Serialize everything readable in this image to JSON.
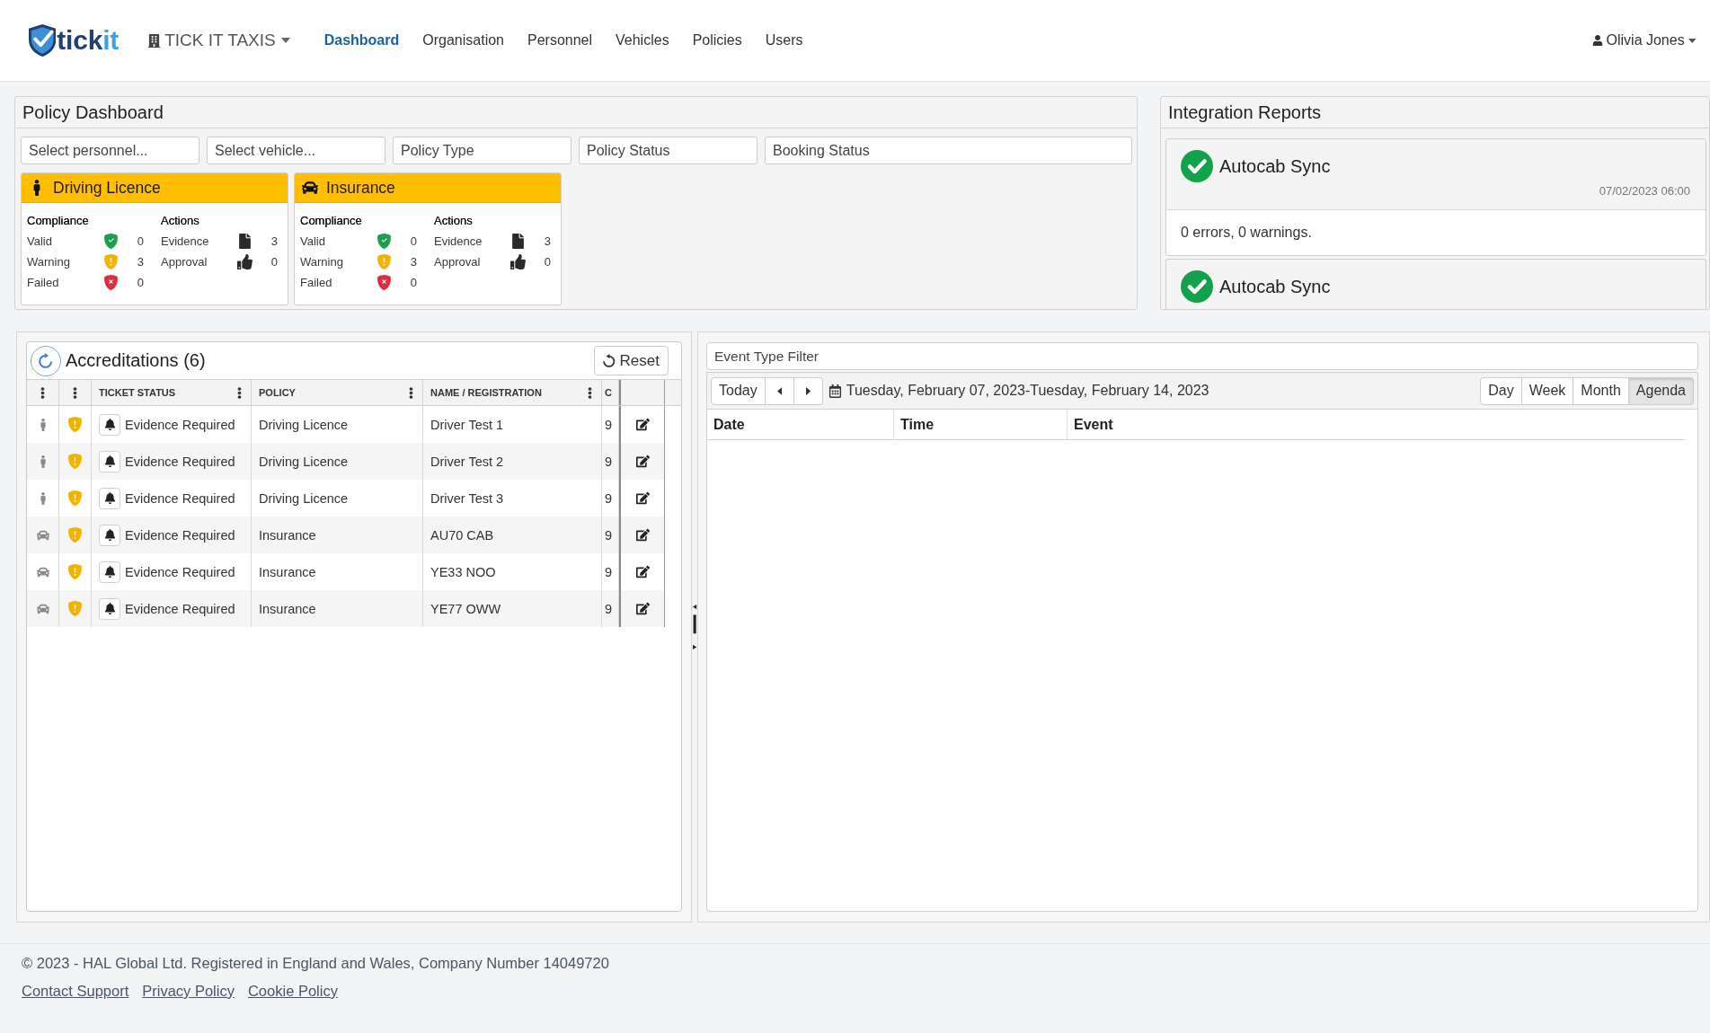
{
  "header": {
    "logo": [
      {
        "text": "tick",
        "color": "#22406e"
      },
      {
        "text": "it",
        "color": "#3f9fe0"
      }
    ],
    "organisation": "TICK IT TAXIS",
    "nav": [
      {
        "label": "Dashboard",
        "selected": true
      },
      {
        "label": "Organisation",
        "selected": false
      },
      {
        "label": "Personnel",
        "selected": false
      },
      {
        "label": "Vehicles",
        "selected": false
      },
      {
        "label": "Policies",
        "selected": false
      },
      {
        "label": "Users",
        "selected": false
      }
    ],
    "user": "Olivia Jones"
  },
  "policy_dashboard": {
    "title": "Policy Dashboard",
    "filters": [
      {
        "placeholder": "Select personnel..."
      },
      {
        "placeholder": "Select vehicle..."
      },
      {
        "placeholder": "Policy Type"
      },
      {
        "placeholder": "Policy Status"
      },
      {
        "placeholder": "Booking Status"
      }
    ],
    "cards": [
      {
        "kind": "person",
        "title": "Driving Licence",
        "compliance_heading": "Compliance",
        "actions_heading": "Actions",
        "compliance": [
          {
            "kind": "valid",
            "label": "Valid",
            "count": "0"
          },
          {
            "kind": "warning",
            "label": "Warning",
            "count": "3"
          },
          {
            "kind": "failed",
            "label": "Failed",
            "count": "0"
          }
        ],
        "actions": [
          {
            "kind": "evidence",
            "label": "Evidence",
            "count": "3"
          },
          {
            "kind": "approval",
            "label": "Approval",
            "count": "0"
          }
        ]
      },
      {
        "kind": "car",
        "title": "Insurance",
        "compliance_heading": "Compliance",
        "actions_heading": "Actions",
        "compliance": [
          {
            "kind": "valid",
            "label": "Valid",
            "count": "0"
          },
          {
            "kind": "warning",
            "label": "Warning",
            "count": "3"
          },
          {
            "kind": "failed",
            "label": "Failed",
            "count": "0"
          }
        ],
        "actions": [
          {
            "kind": "evidence",
            "label": "Evidence",
            "count": "3"
          },
          {
            "kind": "approval",
            "label": "Approval",
            "count": "0"
          }
        ]
      }
    ]
  },
  "integration_reports": {
    "title": "Integration Reports",
    "reports": [
      {
        "kind": "success",
        "name": "Autocab Sync",
        "time": "07/02/2023 06:00",
        "summary": "0 errors, 0 warnings."
      },
      {
        "kind": "success",
        "name": "Autocab Sync"
      }
    ]
  },
  "accreditations": {
    "title": "Accreditations (6)",
    "reset_label": "Reset",
    "columns": [
      {
        "label": "TICKET STATUS",
        "menu": true
      },
      {
        "label": "POLICY",
        "menu": true
      },
      {
        "label": "NAME / REGISTRATION",
        "menu": true
      },
      {
        "label": "C",
        "menu": false
      }
    ],
    "rows": [
      {
        "kind": "person",
        "compliance": {
          "kind": "warning"
        },
        "ticket_status": "Evidence Required",
        "policy": "Driving Licence",
        "name": "Driver Test 1",
        "column_6": "9"
      },
      {
        "kind": "person",
        "compliance": {
          "kind": "warning"
        },
        "ticket_status": "Evidence Required",
        "policy": "Driving Licence",
        "name": "Driver Test 2",
        "column_6": "9"
      },
      {
        "kind": "person",
        "compliance": {
          "kind": "warning"
        },
        "ticket_status": "Evidence Required",
        "policy": "Driving Licence",
        "name": "Driver Test 3",
        "column_6": "9"
      },
      {
        "kind": "car",
        "compliance": {
          "kind": "warning"
        },
        "ticket_status": "Evidence Required",
        "policy": "Insurance",
        "name": "AU70 CAB",
        "column_6": "9"
      },
      {
        "kind": "car",
        "compliance": {
          "kind": "warning"
        },
        "ticket_status": "Evidence Required",
        "policy": "Insurance",
        "name": "YE33 NOO",
        "column_6": "9"
      },
      {
        "kind": "car",
        "compliance": {
          "kind": "warning"
        },
        "ticket_status": "Evidence Required",
        "policy": "Insurance",
        "name": "YE77 OWW",
        "column_6": "9"
      }
    ]
  },
  "calendar": {
    "filter_placeholder": "Event Type Filter",
    "today_label": "Today",
    "range": "Tuesday, February 07, 2023-Tuesday, February 14, 2023",
    "views": [
      {
        "label": "Day",
        "selected": false
      },
      {
        "label": "Week",
        "selected": false
      },
      {
        "label": "Month",
        "selected": false
      },
      {
        "label": "Agenda",
        "selected": true
      }
    ],
    "columns": [
      "Date",
      "Time",
      "Event"
    ]
  },
  "footer": {
    "copyright": "© 2023 - HAL Global Ltd. Registered in England and Wales, Company Number 14049720",
    "links": [
      "Contact Support",
      "Privacy Policy",
      "Cookie Policy"
    ]
  }
}
